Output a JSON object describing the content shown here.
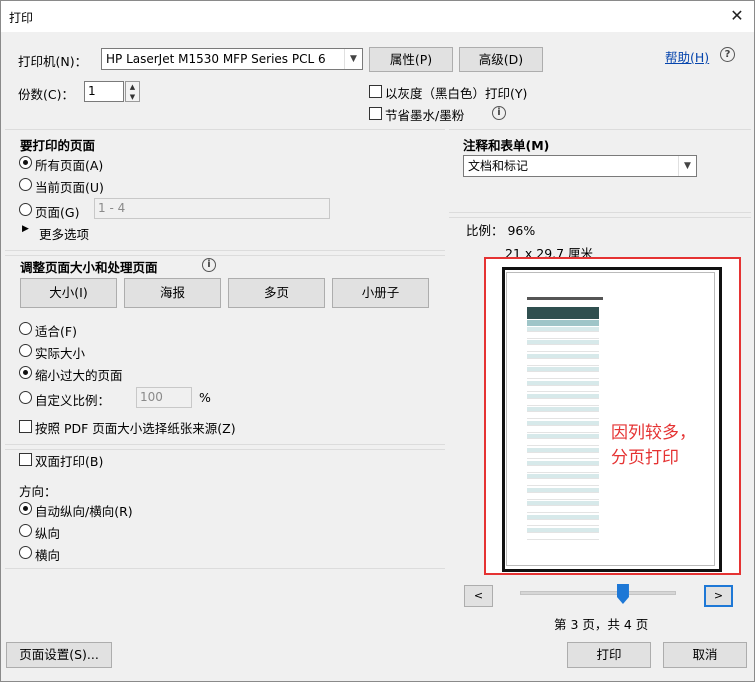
{
  "window": {
    "title": "打印",
    "close_glyph": "✕"
  },
  "printer": {
    "label": "打印机(N)：",
    "value": "HP LaserJet M1530 MFP Series PCL 6",
    "properties_button": "属性(P)",
    "advanced_button": "高级(D)",
    "help_link": "帮助(H)",
    "help_icon_glyph": "?"
  },
  "copies": {
    "label": "份数(C)：",
    "value": "1"
  },
  "options": {
    "grayscale": "以灰度（黑白色）打印(Y)",
    "save_ink": "节省墨水/墨粉"
  },
  "pages": {
    "title": "要打印的页面",
    "all": "所有页面(A)",
    "current": "当前页面(U)",
    "range": "页面(G)",
    "range_value": "1 - 4",
    "more": "更多选项"
  },
  "sizing": {
    "title": "调整页面大小和处理页面",
    "tabs": [
      "大小(I)",
      "海报",
      "多页",
      "小册子"
    ],
    "fit": "适合(F)",
    "actual": "实际大小",
    "shrink": "缩小过大的页面",
    "custom": "自定义比例：",
    "custom_value": "100",
    "percent": "%",
    "pdf_source": "按照 PDF 页面大小选择纸张来源(Z)"
  },
  "duplex": {
    "label": "双面打印(B)"
  },
  "orientation": {
    "title": "方向：",
    "auto": "自动纵向/横向(R)",
    "portrait": "纵向",
    "landscape": "横向"
  },
  "comments": {
    "title": "注释和表单(M)",
    "value": "文档和标记"
  },
  "preview": {
    "scale": "比例： 96%",
    "size": "21 x 29.7 厘米",
    "annotation_line1": "因列较多，",
    "annotation_line2": "分页打印",
    "prev": "<",
    "next": ">",
    "page_status": "第 3 页，共 4 页",
    "page_slider_fraction": 0.66
  },
  "footer": {
    "page_setup": "页面设置(S)...",
    "print": "打印",
    "cancel": "取消"
  },
  "colors": {
    "accent_red": "#e53333",
    "link_blue": "#0645ad",
    "slider_blue": "#1e78d6",
    "sheet_header": "#2f4f4f"
  }
}
